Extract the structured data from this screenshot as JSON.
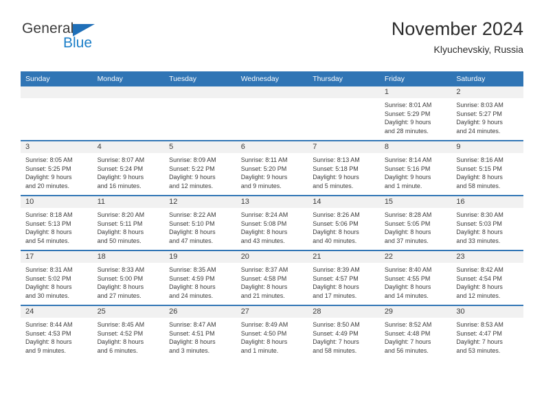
{
  "logo": {
    "word_one": "General",
    "word_two": "Blue",
    "triangle_color": "#1f6fb8",
    "blue_color": "#1a7ec8"
  },
  "header": {
    "title": "November 2024",
    "subtitle": "Klyuchevskiy, Russia"
  },
  "theme": {
    "header_bg": "#3075b5",
    "header_text": "#ffffff",
    "daynum_bg": "#f1f1f1",
    "cell_bg": "#ffffff",
    "text": "#3a3a3a"
  },
  "calendar": {
    "weekday_headers": [
      "Sunday",
      "Monday",
      "Tuesday",
      "Wednesday",
      "Thursday",
      "Friday",
      "Saturday"
    ],
    "weeks": [
      [
        {
          "day": "",
          "sunrise": "",
          "sunset": "",
          "daylight_line1": "",
          "daylight_line2": ""
        },
        {
          "day": "",
          "sunrise": "",
          "sunset": "",
          "daylight_line1": "",
          "daylight_line2": ""
        },
        {
          "day": "",
          "sunrise": "",
          "sunset": "",
          "daylight_line1": "",
          "daylight_line2": ""
        },
        {
          "day": "",
          "sunrise": "",
          "sunset": "",
          "daylight_line1": "",
          "daylight_line2": ""
        },
        {
          "day": "",
          "sunrise": "",
          "sunset": "",
          "daylight_line1": "",
          "daylight_line2": ""
        },
        {
          "day": "1",
          "sunrise": "Sunrise: 8:01 AM",
          "sunset": "Sunset: 5:29 PM",
          "daylight_line1": "Daylight: 9 hours",
          "daylight_line2": "and 28 minutes."
        },
        {
          "day": "2",
          "sunrise": "Sunrise: 8:03 AM",
          "sunset": "Sunset: 5:27 PM",
          "daylight_line1": "Daylight: 9 hours",
          "daylight_line2": "and 24 minutes."
        }
      ],
      [
        {
          "day": "3",
          "sunrise": "Sunrise: 8:05 AM",
          "sunset": "Sunset: 5:25 PM",
          "daylight_line1": "Daylight: 9 hours",
          "daylight_line2": "and 20 minutes."
        },
        {
          "day": "4",
          "sunrise": "Sunrise: 8:07 AM",
          "sunset": "Sunset: 5:24 PM",
          "daylight_line1": "Daylight: 9 hours",
          "daylight_line2": "and 16 minutes."
        },
        {
          "day": "5",
          "sunrise": "Sunrise: 8:09 AM",
          "sunset": "Sunset: 5:22 PM",
          "daylight_line1": "Daylight: 9 hours",
          "daylight_line2": "and 12 minutes."
        },
        {
          "day": "6",
          "sunrise": "Sunrise: 8:11 AM",
          "sunset": "Sunset: 5:20 PM",
          "daylight_line1": "Daylight: 9 hours",
          "daylight_line2": "and 9 minutes."
        },
        {
          "day": "7",
          "sunrise": "Sunrise: 8:13 AM",
          "sunset": "Sunset: 5:18 PM",
          "daylight_line1": "Daylight: 9 hours",
          "daylight_line2": "and 5 minutes."
        },
        {
          "day": "8",
          "sunrise": "Sunrise: 8:14 AM",
          "sunset": "Sunset: 5:16 PM",
          "daylight_line1": "Daylight: 9 hours",
          "daylight_line2": "and 1 minute."
        },
        {
          "day": "9",
          "sunrise": "Sunrise: 8:16 AM",
          "sunset": "Sunset: 5:15 PM",
          "daylight_line1": "Daylight: 8 hours",
          "daylight_line2": "and 58 minutes."
        }
      ],
      [
        {
          "day": "10",
          "sunrise": "Sunrise: 8:18 AM",
          "sunset": "Sunset: 5:13 PM",
          "daylight_line1": "Daylight: 8 hours",
          "daylight_line2": "and 54 minutes."
        },
        {
          "day": "11",
          "sunrise": "Sunrise: 8:20 AM",
          "sunset": "Sunset: 5:11 PM",
          "daylight_line1": "Daylight: 8 hours",
          "daylight_line2": "and 50 minutes."
        },
        {
          "day": "12",
          "sunrise": "Sunrise: 8:22 AM",
          "sunset": "Sunset: 5:10 PM",
          "daylight_line1": "Daylight: 8 hours",
          "daylight_line2": "and 47 minutes."
        },
        {
          "day": "13",
          "sunrise": "Sunrise: 8:24 AM",
          "sunset": "Sunset: 5:08 PM",
          "daylight_line1": "Daylight: 8 hours",
          "daylight_line2": "and 43 minutes."
        },
        {
          "day": "14",
          "sunrise": "Sunrise: 8:26 AM",
          "sunset": "Sunset: 5:06 PM",
          "daylight_line1": "Daylight: 8 hours",
          "daylight_line2": "and 40 minutes."
        },
        {
          "day": "15",
          "sunrise": "Sunrise: 8:28 AM",
          "sunset": "Sunset: 5:05 PM",
          "daylight_line1": "Daylight: 8 hours",
          "daylight_line2": "and 37 minutes."
        },
        {
          "day": "16",
          "sunrise": "Sunrise: 8:30 AM",
          "sunset": "Sunset: 5:03 PM",
          "daylight_line1": "Daylight: 8 hours",
          "daylight_line2": "and 33 minutes."
        }
      ],
      [
        {
          "day": "17",
          "sunrise": "Sunrise: 8:31 AM",
          "sunset": "Sunset: 5:02 PM",
          "daylight_line1": "Daylight: 8 hours",
          "daylight_line2": "and 30 minutes."
        },
        {
          "day": "18",
          "sunrise": "Sunrise: 8:33 AM",
          "sunset": "Sunset: 5:00 PM",
          "daylight_line1": "Daylight: 8 hours",
          "daylight_line2": "and 27 minutes."
        },
        {
          "day": "19",
          "sunrise": "Sunrise: 8:35 AM",
          "sunset": "Sunset: 4:59 PM",
          "daylight_line1": "Daylight: 8 hours",
          "daylight_line2": "and 24 minutes."
        },
        {
          "day": "20",
          "sunrise": "Sunrise: 8:37 AM",
          "sunset": "Sunset: 4:58 PM",
          "daylight_line1": "Daylight: 8 hours",
          "daylight_line2": "and 21 minutes."
        },
        {
          "day": "21",
          "sunrise": "Sunrise: 8:39 AM",
          "sunset": "Sunset: 4:57 PM",
          "daylight_line1": "Daylight: 8 hours",
          "daylight_line2": "and 17 minutes."
        },
        {
          "day": "22",
          "sunrise": "Sunrise: 8:40 AM",
          "sunset": "Sunset: 4:55 PM",
          "daylight_line1": "Daylight: 8 hours",
          "daylight_line2": "and 14 minutes."
        },
        {
          "day": "23",
          "sunrise": "Sunrise: 8:42 AM",
          "sunset": "Sunset: 4:54 PM",
          "daylight_line1": "Daylight: 8 hours",
          "daylight_line2": "and 12 minutes."
        }
      ],
      [
        {
          "day": "24",
          "sunrise": "Sunrise: 8:44 AM",
          "sunset": "Sunset: 4:53 PM",
          "daylight_line1": "Daylight: 8 hours",
          "daylight_line2": "and 9 minutes."
        },
        {
          "day": "25",
          "sunrise": "Sunrise: 8:45 AM",
          "sunset": "Sunset: 4:52 PM",
          "daylight_line1": "Daylight: 8 hours",
          "daylight_line2": "and 6 minutes."
        },
        {
          "day": "26",
          "sunrise": "Sunrise: 8:47 AM",
          "sunset": "Sunset: 4:51 PM",
          "daylight_line1": "Daylight: 8 hours",
          "daylight_line2": "and 3 minutes."
        },
        {
          "day": "27",
          "sunrise": "Sunrise: 8:49 AM",
          "sunset": "Sunset: 4:50 PM",
          "daylight_line1": "Daylight: 8 hours",
          "daylight_line2": "and 1 minute."
        },
        {
          "day": "28",
          "sunrise": "Sunrise: 8:50 AM",
          "sunset": "Sunset: 4:49 PM",
          "daylight_line1": "Daylight: 7 hours",
          "daylight_line2": "and 58 minutes."
        },
        {
          "day": "29",
          "sunrise": "Sunrise: 8:52 AM",
          "sunset": "Sunset: 4:48 PM",
          "daylight_line1": "Daylight: 7 hours",
          "daylight_line2": "and 56 minutes."
        },
        {
          "day": "30",
          "sunrise": "Sunrise: 8:53 AM",
          "sunset": "Sunset: 4:47 PM",
          "daylight_line1": "Daylight: 7 hours",
          "daylight_line2": "and 53 minutes."
        }
      ]
    ]
  }
}
